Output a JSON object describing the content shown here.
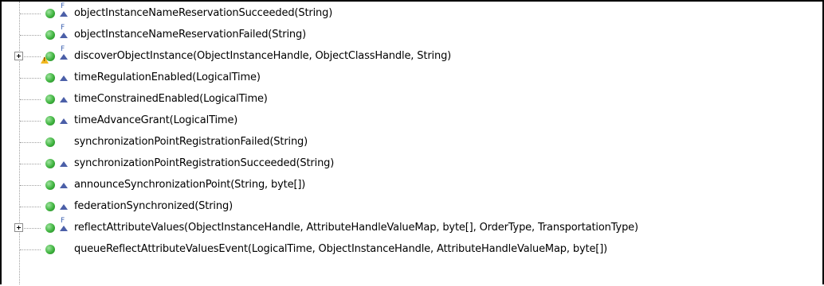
{
  "methods": [
    {
      "label": "objectInstanceNameReservationSucceeded(String)",
      "icon": "method-public-icon",
      "final": true,
      "override": true,
      "expandable": false,
      "warning": false
    },
    {
      "label": "objectInstanceNameReservationFailed(String)",
      "icon": "method-public-icon",
      "final": true,
      "override": true,
      "expandable": false,
      "warning": false
    },
    {
      "label": "discoverObjectInstance(ObjectInstanceHandle, ObjectClassHandle, String)",
      "icon": "method-public-icon",
      "final": true,
      "override": true,
      "expandable": true,
      "warning": true
    },
    {
      "label": "timeRegulationEnabled(LogicalTime)",
      "icon": "method-public-icon",
      "final": false,
      "override": true,
      "expandable": false,
      "warning": false
    },
    {
      "label": "timeConstrainedEnabled(LogicalTime)",
      "icon": "method-public-icon",
      "final": false,
      "override": true,
      "expandable": false,
      "warning": false
    },
    {
      "label": "timeAdvanceGrant(LogicalTime)",
      "icon": "method-public-icon",
      "final": false,
      "override": true,
      "expandable": false,
      "warning": false
    },
    {
      "label": "synchronizationPointRegistrationFailed(String)",
      "icon": "method-public-icon",
      "final": false,
      "override": false,
      "expandable": false,
      "warning": false
    },
    {
      "label": "synchronizationPointRegistrationSucceeded(String)",
      "icon": "method-public-icon",
      "final": false,
      "override": true,
      "expandable": false,
      "warning": false
    },
    {
      "label": "announceSynchronizationPoint(String, byte[])",
      "icon": "method-public-icon",
      "final": false,
      "override": true,
      "expandable": false,
      "warning": false
    },
    {
      "label": "federationSynchronized(String)",
      "icon": "method-public-icon",
      "final": false,
      "override": true,
      "expandable": false,
      "warning": false
    },
    {
      "label": "reflectAttributeValues(ObjectInstanceHandle, AttributeHandleValueMap, byte[], OrderType, TransportationType)",
      "icon": "method-public-icon",
      "final": true,
      "override": true,
      "expandable": true,
      "warning": false
    },
    {
      "label": "queueReflectAttributeValuesEvent(LogicalTime, ObjectInstanceHandle, AttributeHandleValueMap, byte[])",
      "icon": "method-public-icon",
      "final": false,
      "override": false,
      "expandable": false,
      "warning": false
    }
  ],
  "final_mark": "F",
  "warning_mark": "!"
}
